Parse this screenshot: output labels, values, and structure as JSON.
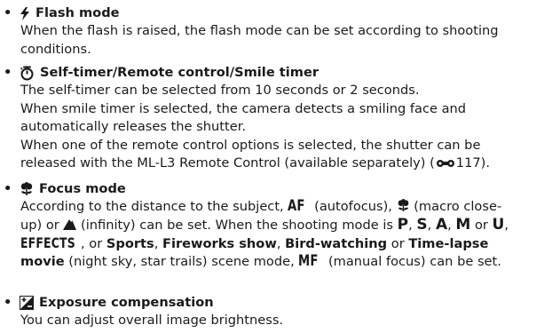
{
  "items": [
    {
      "heading": "Flash mode",
      "icon": "flash-icon",
      "lines": [
        "When the flash is raised, the flash mode can be set according to shooting",
        "conditions."
      ]
    },
    {
      "heading": "Self-timer/Remote control/Smile timer",
      "icon": "self-timer-icon",
      "lines": [
        "The self-timer can be selected from 10 seconds or 2 seconds.",
        "When smile timer is selected, the camera detects a smiling face and",
        "automatically releases the shutter.",
        "When one of the remote control options is selected, the shutter can be",
        "released with the ML-L3 Remote Control (available separately) ("
      ],
      "ref_page": "117",
      "ref_close": ")."
    },
    {
      "heading": "Focus mode",
      "icon": "macro-flower-icon",
      "line1": [
        "According to the distance to the subject, ",
        "AF",
        " (autofocus), ",
        " (macro close-"
      ],
      "line2": [
        "up) or ",
        " (infinity) can be set. When the shooting mode is "
      ],
      "modes": [
        "P",
        "S",
        "A",
        "M",
        "U"
      ],
      "line2_seps": [
        ", ",
        ", ",
        ", ",
        " or ",
        ","
      ],
      "line3": [
        "EFFECTS",
        ", or ",
        "Sports",
        ", ",
        "Fireworks show",
        ", ",
        "Bird-watching",
        " or ",
        "Time-lapse"
      ],
      "line4": [
        "movie",
        " (night sky, star trails) scene mode, ",
        "MF",
        " (manual focus) can be set."
      ]
    },
    {
      "heading": "Exposure compensation",
      "icon": "exposure-compensation-icon",
      "lines": [
        "You can adjust overall image brightness."
      ]
    }
  ],
  "bullet_char": "•"
}
